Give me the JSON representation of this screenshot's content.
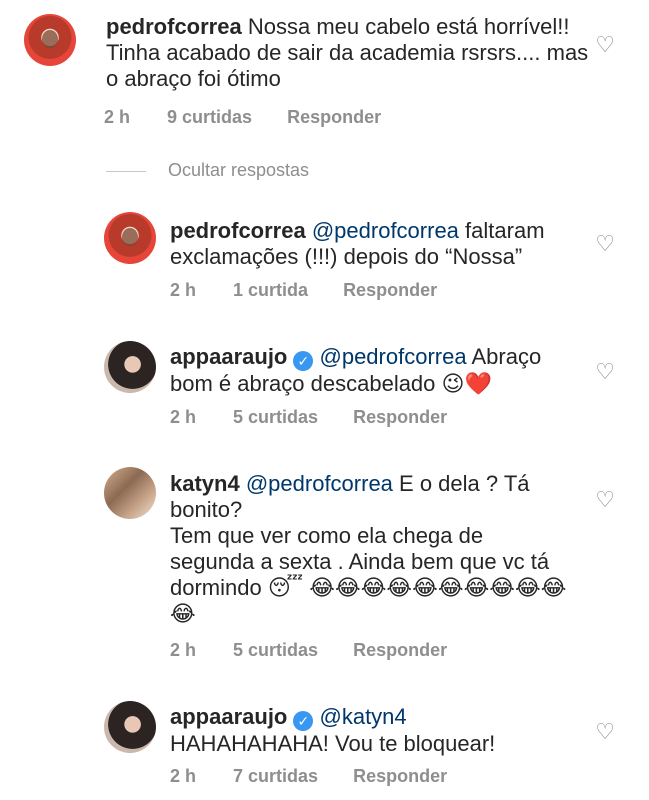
{
  "toggle_label": "Ocultar respostas",
  "comments": [
    {
      "username": "pedrofcorrea",
      "text": "Nossa meu cabelo está horrível!! Tinha acabado de sair da academia rsrsrs.... mas o abraço foi ótimo",
      "time": "2 h",
      "likes": "9 curtidas",
      "reply": "Responder"
    },
    {
      "username": "pedrofcorrea",
      "mention": "@pedrofcorrea",
      "text": "faltaram exclamações (!!!) depois do “Nossa”",
      "time": "2 h",
      "likes": "1 curtida",
      "reply": "Responder"
    },
    {
      "username": "appaaraujo",
      "verified": true,
      "mention": "@pedrofcorrea",
      "text": "Abraço bom é abraço descabelado",
      "emojis": [
        "😉",
        "❤️"
      ],
      "time": "2 h",
      "likes": "5 curtidas",
      "reply": "Responder"
    },
    {
      "username": "katyn4",
      "mention": "@pedrofcorrea",
      "text_line1": "E o dela ? Tá",
      "text_line2": "bonito?",
      "text_line3": "Tem que ver como ela chega de",
      "text_line4": "segunda a sexta . Ainda bem que vc tá",
      "text_line5": "dormindo",
      "emojis": [
        "😴",
        "😂"
      ],
      "time": "2 h",
      "likes": "5 curtidas",
      "reply": "Responder"
    },
    {
      "username": "appaaraujo",
      "verified": true,
      "mention": "@katyn4",
      "text": "HAHAHAHAHA! Vou te bloquear!",
      "time": "2 h",
      "likes": "7 curtidas",
      "reply": "Responder"
    }
  ]
}
